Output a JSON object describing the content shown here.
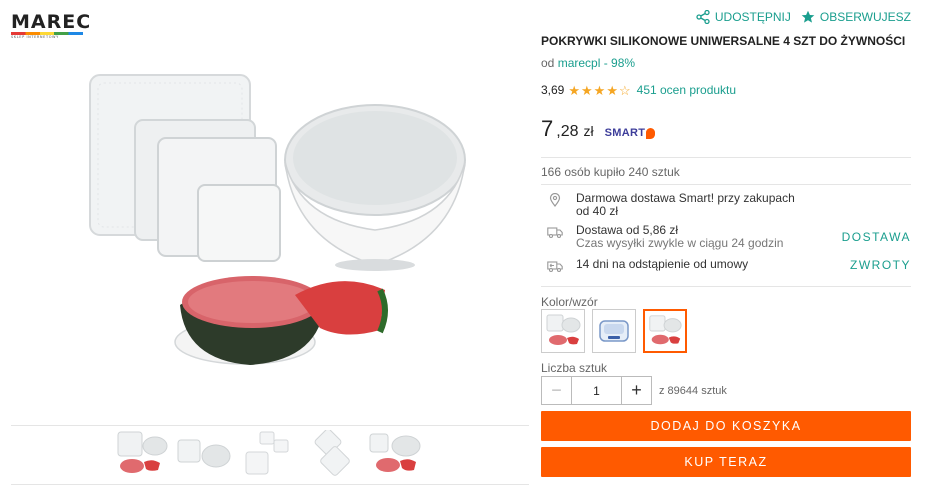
{
  "brand": {
    "name": "MAREC",
    "tagline": "SKLEP INTERNETOWY"
  },
  "header_actions": {
    "share_label": "UDOSTĘPNIJ",
    "watch_label": "OBSERWUJESZ"
  },
  "product": {
    "title": "POKRYWKI SILIKONOWE UNIWERSALNE 4 SZT DO ŻYWNOŚCI",
    "seller_prefix": "od",
    "seller_link": "marecpl - 98%",
    "rating_value": "3,69",
    "rating_stars": 3.69,
    "rating_count": "451 ocen produktu",
    "price_int": "7",
    "price_dec": ",28",
    "price_currency": "zł",
    "smart_label": "SMART",
    "bought": "166 osób kupiło 240 sztuk"
  },
  "shipping": {
    "free_line1": "Darmowa dostawa Smart! przy zakupach",
    "free_line2": "od 40 zł",
    "delivery_line1": "Dostawa od 5,86 zł",
    "delivery_line2": "Czas wysyłki zwykle w ciągu 24 godzin",
    "delivery_link": "DOSTAWA",
    "return_line": "14 dni na odstąpienie od umowy",
    "return_link": "ZWROTY"
  },
  "options": {
    "variant_label": "Kolor/wzór",
    "quantity_label": "Liczba sztuk",
    "quantity_value": "1",
    "stock_text": "z 89644 sztuk",
    "minus": "−",
    "plus": "+"
  },
  "buttons": {
    "add_to_cart": "DODAJ DO KOSZYKA",
    "buy_now": "KUP TERAZ"
  },
  "colors": {
    "accent_teal": "#1a9e8e",
    "accent_orange": "#ff5a00",
    "star": "#f5a623"
  }
}
